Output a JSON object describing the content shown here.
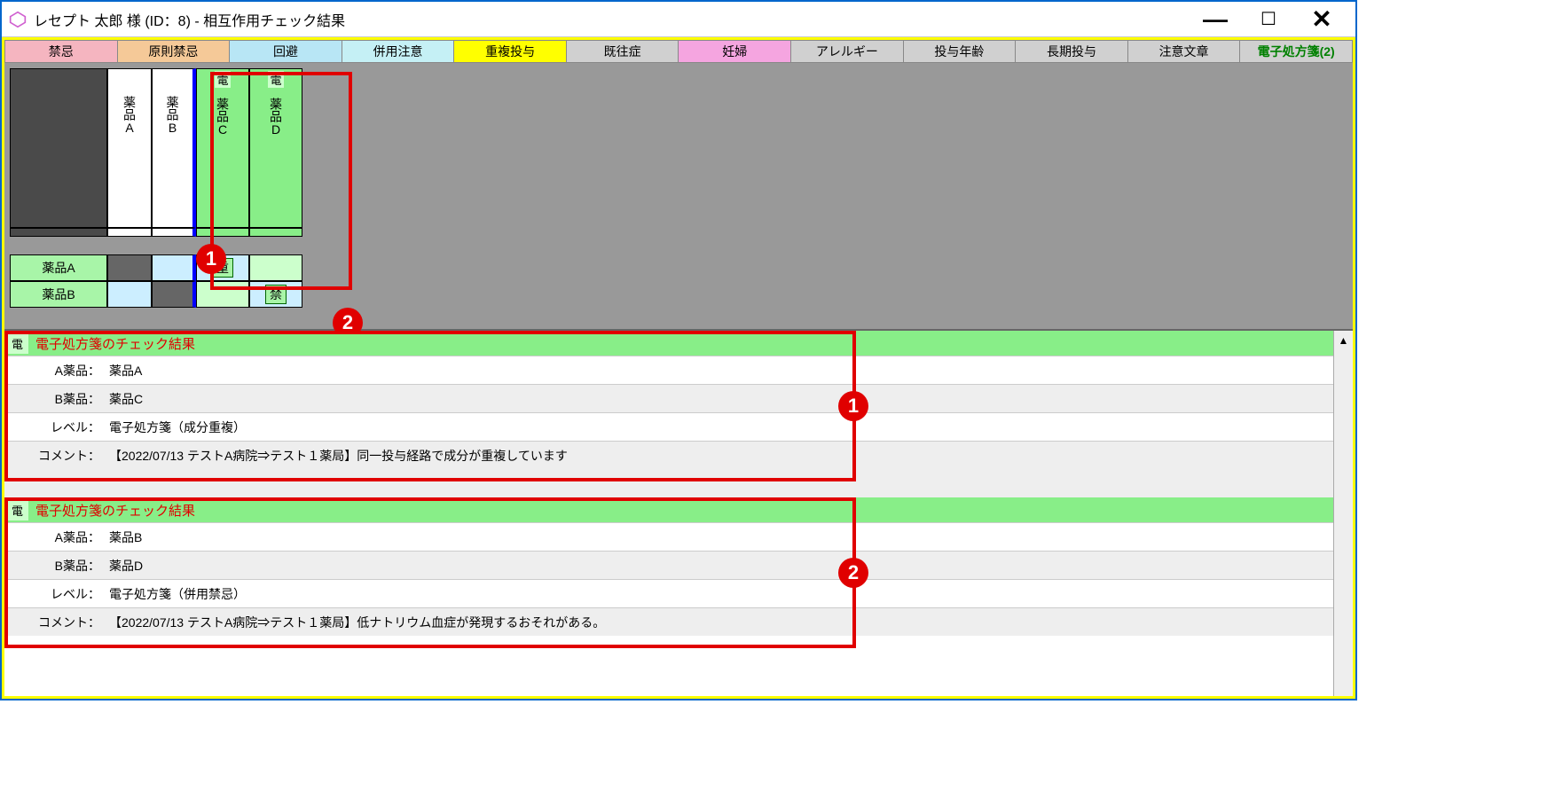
{
  "window": {
    "title": "レセプト 太郎 様 (ID：8) - 相互作用チェック結果"
  },
  "tabs": [
    {
      "label": "禁忌",
      "cls": "pink"
    },
    {
      "label": "原則禁忌",
      "cls": "orange"
    },
    {
      "label": "回避",
      "cls": "lightblue"
    },
    {
      "label": "併用注意",
      "cls": "cyan"
    },
    {
      "label": "重複投与",
      "cls": "yellow"
    },
    {
      "label": "既往症",
      "cls": "gray"
    },
    {
      "label": "妊婦",
      "cls": "magenta"
    },
    {
      "label": "アレルギー",
      "cls": "gray"
    },
    {
      "label": "投与年齢",
      "cls": "gray"
    },
    {
      "label": "長期投与",
      "cls": "gray"
    },
    {
      "label": "注意文章",
      "cls": "gray"
    },
    {
      "label": "電子処方箋(2)",
      "cls": "last"
    }
  ],
  "matrix": {
    "den_tag": "電",
    "col_heads": [
      "薬品A",
      "薬品B",
      "薬品C",
      "薬品D"
    ],
    "row_heads": [
      "薬品A",
      "薬品B"
    ],
    "tag_ju": "重",
    "tag_kin": "禁"
  },
  "callouts": {
    "one": "1",
    "two": "2"
  },
  "results": [
    {
      "header_den": "電",
      "header_title": "電子処方箋のチェック結果",
      "rows": [
        {
          "label": "A薬品：",
          "value": "薬品A"
        },
        {
          "label": "B薬品：",
          "value": "薬品C"
        },
        {
          "label": "レベル：",
          "value": "電子処方箋（成分重複）"
        },
        {
          "label": "コメント：",
          "value": "【2022/07/13 テストA病院⇒テスト１薬局】同一投与経路で成分が重複しています"
        }
      ],
      "callout": "1"
    },
    {
      "header_den": "電",
      "header_title": "電子処方箋のチェック結果",
      "rows": [
        {
          "label": "A薬品：",
          "value": "薬品B"
        },
        {
          "label": "B薬品：",
          "value": "薬品D"
        },
        {
          "label": "レベル：",
          "value": "電子処方箋（併用禁忌）"
        },
        {
          "label": "コメント：",
          "value": "【2022/07/13 テストA病院⇒テスト１薬局】低ナトリウム血症が発現するおそれがある。"
        }
      ],
      "callout": "2"
    }
  ]
}
